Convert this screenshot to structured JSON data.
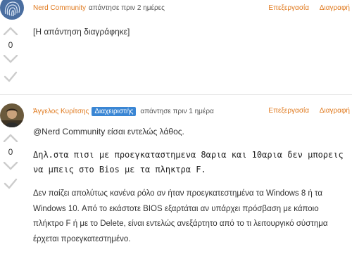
{
  "post1": {
    "author": "Nerd Community",
    "meta_text": "απάντησε πριν 2 ημέρες",
    "edit_label": "Επεξεργασία",
    "delete_label": "Διαγραφή",
    "vote_count": "0",
    "content": "[Η απάντηση διαγράφηκε]"
  },
  "post2": {
    "author": "Άγγελος Κυρίτσης",
    "badge": "Διαχειριστής",
    "meta_text": "απάντησε πριν 1 ημέρα",
    "edit_label": "Επεξεργασία",
    "delete_label": "Διαγραφή",
    "vote_count": "0",
    "mention_text": "@Nerd Community είσαι εντελώς λάθος.",
    "code_text": "Δηλ.στα πισι με προεγκαταστημενα 8αρια και 10αρια δεν μπορεις να μπεις στο Bios με τα πληκτρα F.",
    "body_text": "Δεν παίζει απολύτως κανένα ρόλο αν ήταν προεγκατεστημένα τα Windows 8 ή τα Windows 10. Από το εκάστοτε BIOS εξαρτάται αν υπάρχει πρόσβαση με κάποιο πλήκτρο F ή με το Delete, είναι εντελώς ανεξάρτητο από το τι λειτουργικό σύστημα έρχεται προεγκατεστημένο."
  },
  "colors": {
    "accent": "#e07a1f",
    "badge": "#3a86d4",
    "muted": "#cccccc"
  },
  "icons": [
    "fingerprint-avatar",
    "user-avatar",
    "chevron-up-icon",
    "chevron-down-icon",
    "check-icon"
  ]
}
